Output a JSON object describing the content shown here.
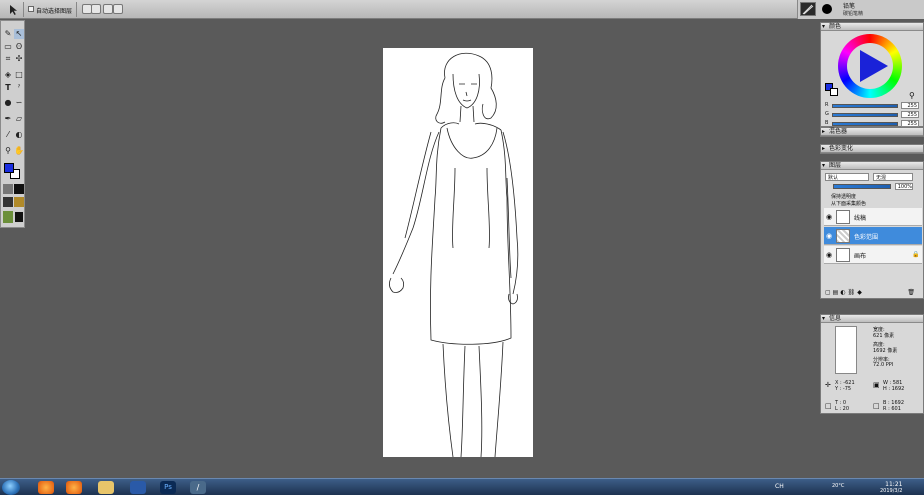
{
  "topbar": {
    "auto_select_label": "自动选择图层"
  },
  "brush": {
    "name": "铅笔",
    "sub": "碳铅笔精"
  },
  "toolbox": {
    "tools": [
      "brush-icon",
      "select-icon",
      "marquee-icon",
      "lasso-icon",
      "crop-icon",
      "move-icon",
      "bucket-icon",
      "shape-icon",
      "text-icon",
      "eyedropper-icon",
      "dodge-icon",
      "smudge-icon",
      "pen-icon",
      "eraser-icon",
      "picker-icon",
      "fill-icon",
      "zoom-icon",
      "hand-icon"
    ]
  },
  "color_panel": {
    "title": "颜色",
    "sliders": [
      {
        "label": "R",
        "value": "255"
      },
      {
        "label": "G",
        "value": "255"
      },
      {
        "label": "B",
        "value": "255"
      }
    ]
  },
  "mixer_panel": {
    "title": "混色器"
  },
  "color_change_panel": {
    "title": "色彩变化"
  },
  "layers_panel": {
    "title": "图层",
    "blend_mode": "默认",
    "blend_option": "无混",
    "opacity": "100%",
    "preserve_transparency": "保持透明度",
    "sample_below": "从下面采集颜色",
    "layers": [
      {
        "name": "线稿",
        "active": false
      },
      {
        "name": "色彩范围",
        "active": true
      },
      {
        "name": "画布",
        "active": false
      }
    ]
  },
  "info_panel": {
    "title": "信息",
    "width_label": "宽度:",
    "width_value": "621 像素",
    "height_label": "高度:",
    "height_value": "1692 像素",
    "res_label": "分辨率:",
    "res_value": "72.0 PPI",
    "x_readout": "X : -621",
    "y_readout": "Y : -75",
    "w_readout": "W : 581",
    "h_readout": "H : 1692",
    "t_readout": "T : 0",
    "l_readout": "L : 20",
    "b_readout": "B : 1692",
    "r_readout": "R : 601"
  },
  "taskbar": {
    "lang": "CH",
    "temp": "20°C",
    "time": "11:21",
    "date": "2019/3/2"
  },
  "colors": {
    "foreground": "#1a2ee0",
    "background": "#ffffff",
    "accent": "#3f8bdc"
  }
}
